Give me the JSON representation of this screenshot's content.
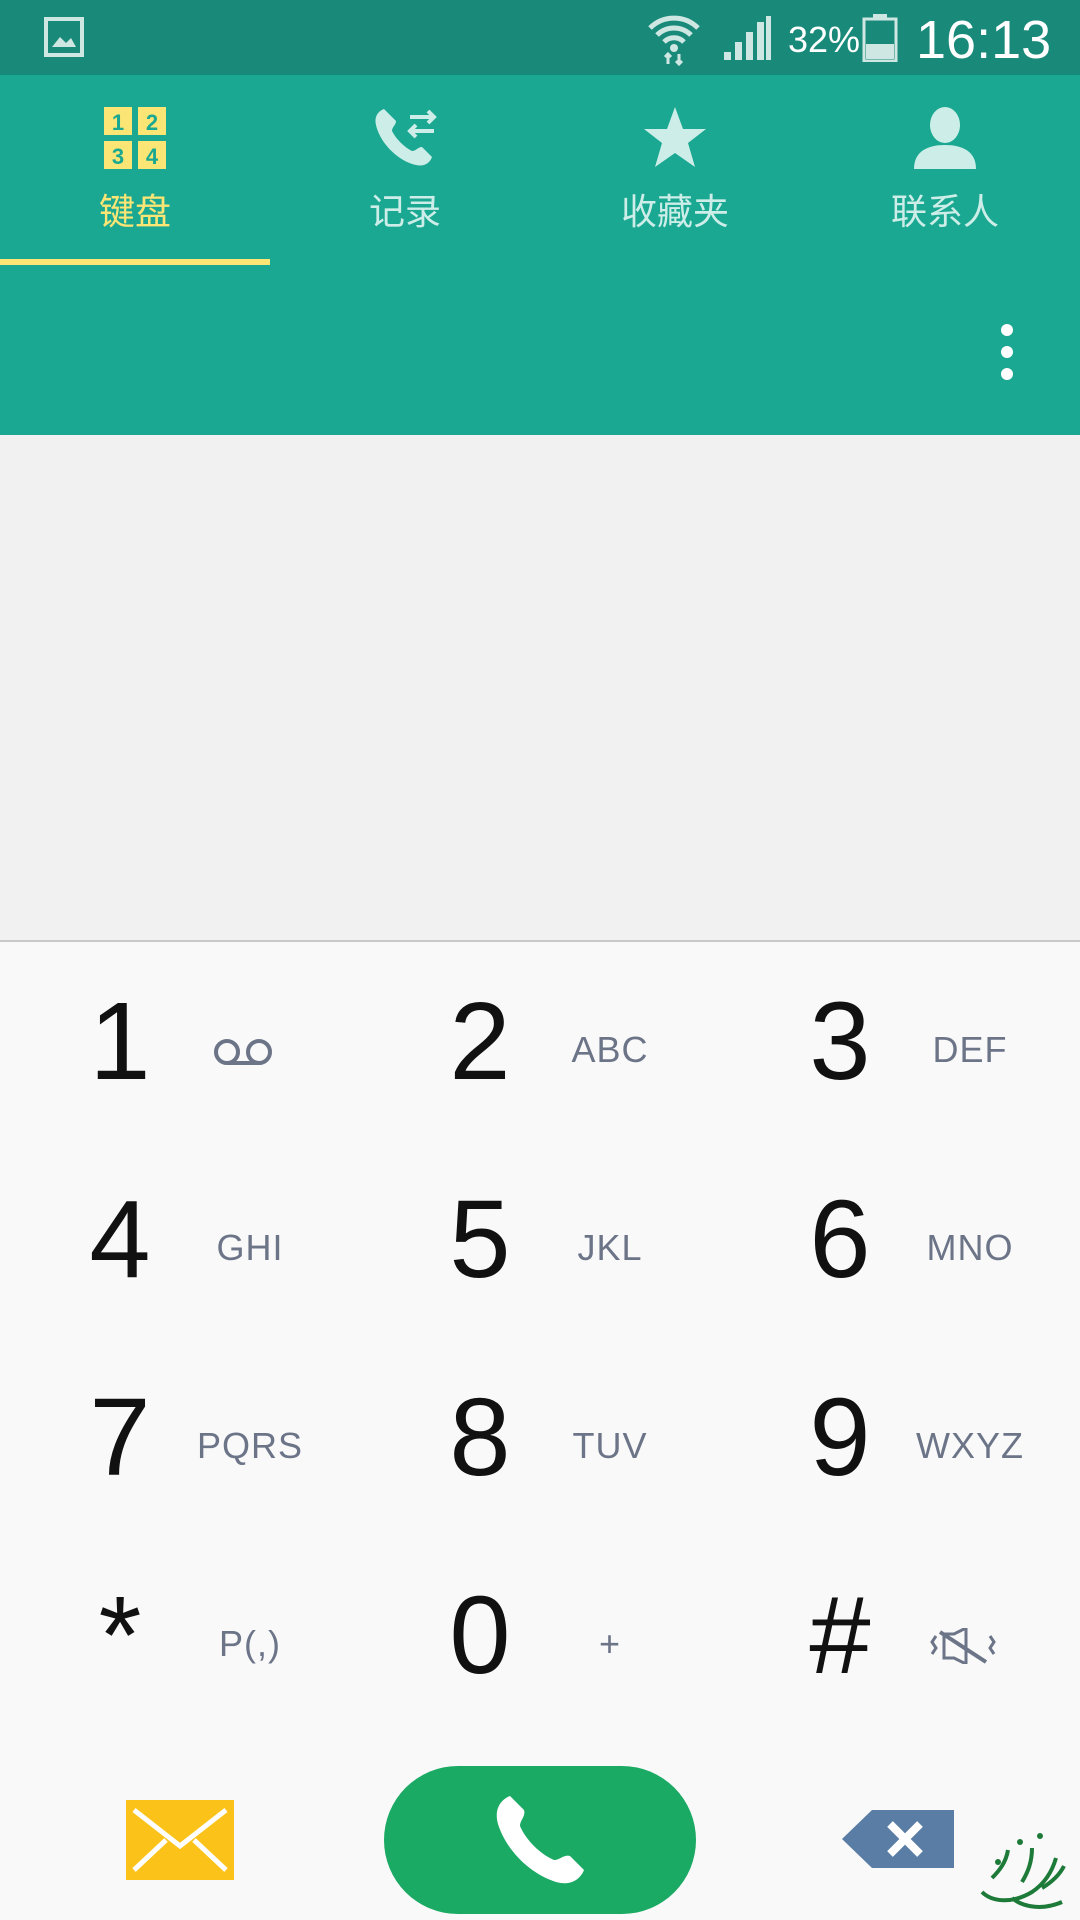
{
  "status_bar": {
    "battery_percent": "32%",
    "time": "16:13",
    "icons": [
      "gallery-notification-icon",
      "wifi-icon",
      "cell-signal-icon",
      "battery-icon"
    ]
  },
  "tabs": [
    {
      "label": "键盘",
      "icon": "dialpad-icon",
      "active": true
    },
    {
      "label": "记录",
      "icon": "call-log-icon",
      "active": false
    },
    {
      "label": "收藏夹",
      "icon": "star-icon",
      "active": false
    },
    {
      "label": "联系人",
      "icon": "person-icon",
      "active": false
    }
  ],
  "header": {
    "more_icon": "more-vertical-icon"
  },
  "keypad": {
    "keys": [
      {
        "digit": "1",
        "letters": "",
        "sub_icon": "voicemail-icon"
      },
      {
        "digit": "2",
        "letters": "ABC"
      },
      {
        "digit": "3",
        "letters": "DEF"
      },
      {
        "digit": "4",
        "letters": "GHI"
      },
      {
        "digit": "5",
        "letters": "JKL"
      },
      {
        "digit": "6",
        "letters": "MNO"
      },
      {
        "digit": "7",
        "letters": "PQRS"
      },
      {
        "digit": "8",
        "letters": "TUV"
      },
      {
        "digit": "9",
        "letters": "WXYZ"
      },
      {
        "digit": "*",
        "letters": "P(,)"
      },
      {
        "digit": "0",
        "letters": "+"
      },
      {
        "digit": "#",
        "letters": "",
        "sub_icon": "vibrate-off-icon"
      }
    ]
  },
  "bottom": {
    "message_icon": "envelope-icon",
    "call_icon": "phone-icon",
    "backspace_icon": "backspace-icon",
    "watermark": "watermark-logo"
  },
  "colors": {
    "status_bar": "#198a7a",
    "tab_bar": "#1ba892",
    "active_tab": "#fbe574",
    "inactive_tab": "#cdeee8",
    "call_button": "#1aaa64",
    "message_button": "#fbc21a",
    "backspace": "#5a7da5"
  }
}
